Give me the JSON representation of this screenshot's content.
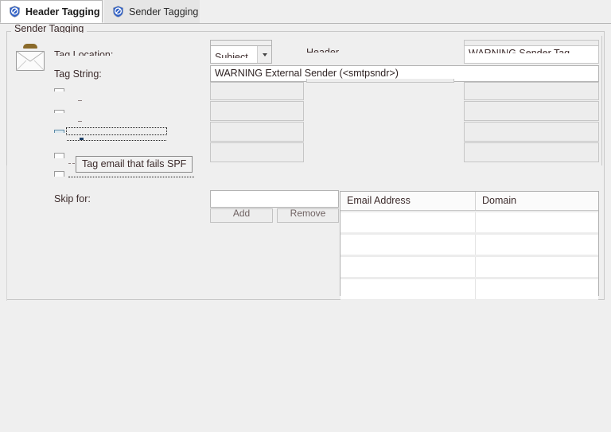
{
  "window": {
    "background": "#efefef"
  },
  "tabs": [
    {
      "label": "Header Tagging",
      "icon": "block-shield-icon",
      "active": true
    },
    {
      "label": "Sender Tagging",
      "icon": "block-shield-icon",
      "active": false
    }
  ],
  "group": {
    "title": "Sender Tagging"
  },
  "form": {
    "tag_location_label": "Tag Location:",
    "tag_location_value": "Subject",
    "tag_string_label": "Tag String:",
    "tag_string_value": "WARNING External Sender (<smtpsndr>)",
    "header_column_label": "Header",
    "sender_tag_value": "WARNING Sender Tag",
    "skip_for_label": "Skip for:",
    "skip_for_value": "",
    "add_label": "Add",
    "remove_label": "Remove"
  },
  "tooltip": {
    "text": "Tag email that fails SPF"
  },
  "table": {
    "columns": [
      "Email Address",
      "Domain"
    ],
    "rows": [
      [
        "",
        ""
      ],
      [
        "",
        ""
      ],
      [
        "",
        ""
      ],
      [
        "",
        ""
      ]
    ]
  },
  "colors": {
    "accent": "#2f5fc4",
    "panel": "#efefef",
    "field_border": "#b3b3b3",
    "text": "#3c2b2b"
  }
}
